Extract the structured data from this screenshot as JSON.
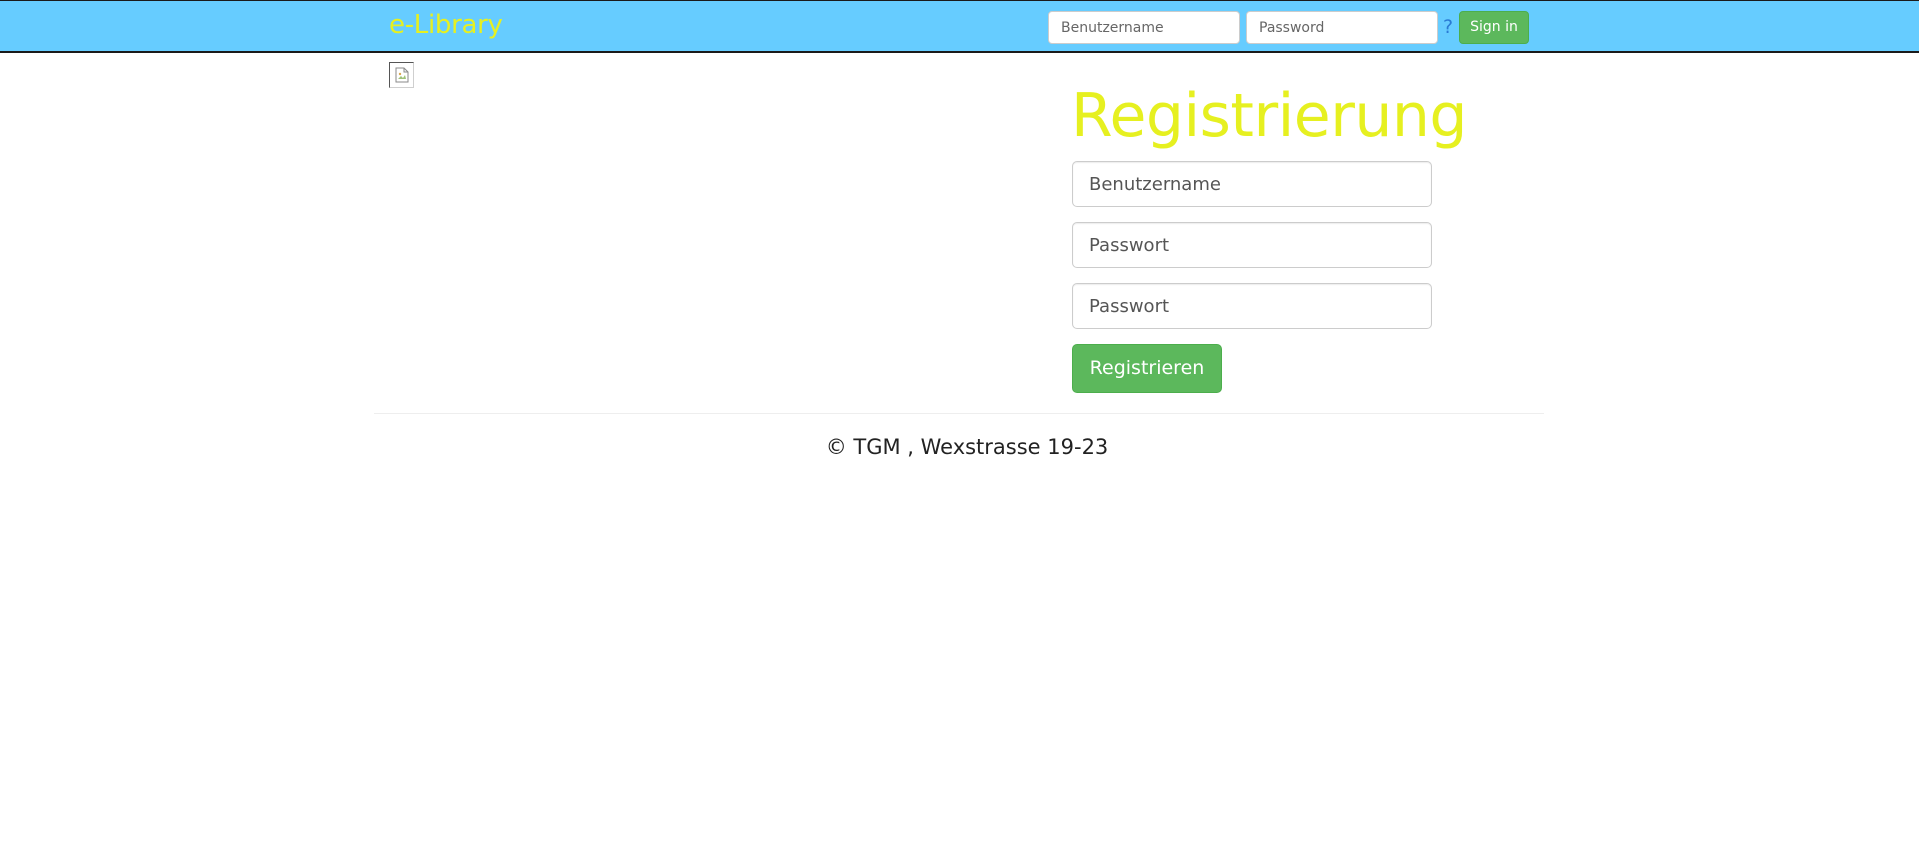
{
  "navbar": {
    "brand": "e-Library",
    "username_placeholder": "Benutzername",
    "password_placeholder": "Password",
    "help_text": "?",
    "signin_label": "Sign in",
    "background_color": "#66ccff",
    "brand_color": "#e6f020"
  },
  "main": {
    "image_icon": "broken-image-icon"
  },
  "registration": {
    "title": "Registrierung",
    "username_placeholder": "Benutzername",
    "password_placeholder": "Passwort",
    "password_confirm_placeholder": "Passwort",
    "submit_label": "Registrieren",
    "button_color": "#5cb85c"
  },
  "footer": {
    "text": "© TGM , Wexstrasse 19-23"
  }
}
